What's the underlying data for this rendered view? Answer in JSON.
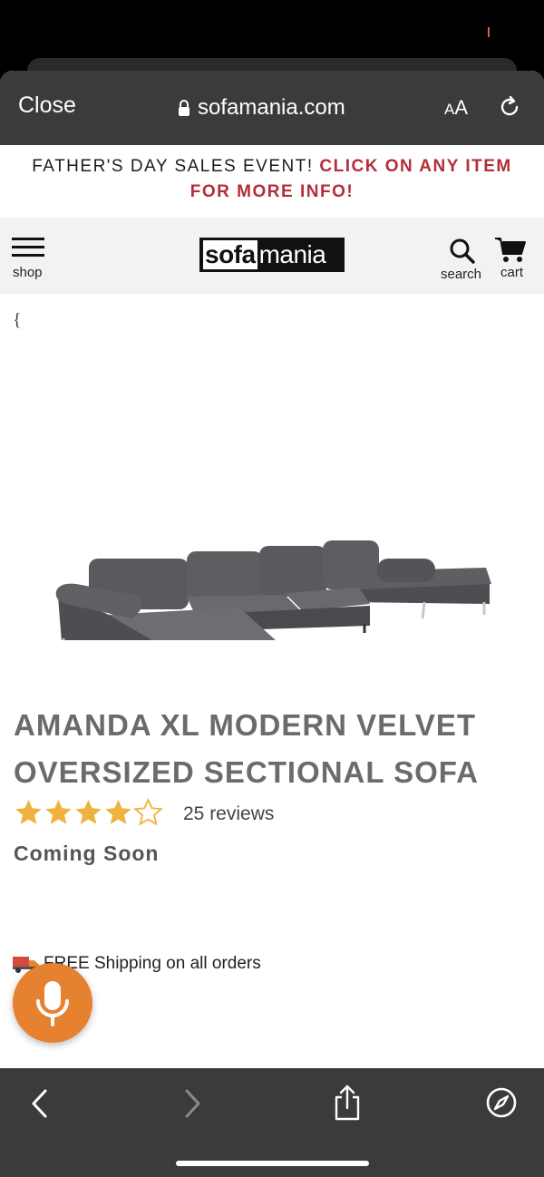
{
  "browser": {
    "close_label": "Close",
    "url": "sofamania.com",
    "text_size_label_small": "A",
    "text_size_label_large": "A"
  },
  "promo": {
    "text_dark": "FATHER'S DAY SALES EVENT!",
    "text_red": "CLICK ON ANY ITEM FOR MORE INFO!",
    "accent_color": "#b42d3a"
  },
  "nav": {
    "shop_label": "shop",
    "logo_part1": "sofa",
    "logo_part2": "mania",
    "search_label": "search",
    "cart_label": "cart"
  },
  "page": {
    "stray_brace": "{"
  },
  "product": {
    "title": "AMANDA XL MODERN VELVET OVERSIZED SECTIONAL SOFA",
    "rating": 4,
    "rating_max": 5,
    "reviews_label": "25 reviews",
    "status": "Coming Soon",
    "shipping_text": "FREE Shipping on all orders",
    "star_color": "#f0b23e"
  },
  "icons": {
    "lock": "lock-icon",
    "reload": "reload-icon",
    "menu": "hamburger-menu-icon",
    "search": "search-icon",
    "cart": "cart-icon",
    "truck": "truck-icon",
    "mic": "microphone-icon",
    "back": "chevron-left-icon",
    "forward": "chevron-right-icon",
    "share": "share-icon",
    "safari": "compass-icon"
  },
  "colors": {
    "browser_chrome": "#3b3b3d",
    "mic_button": "#e6812f"
  }
}
